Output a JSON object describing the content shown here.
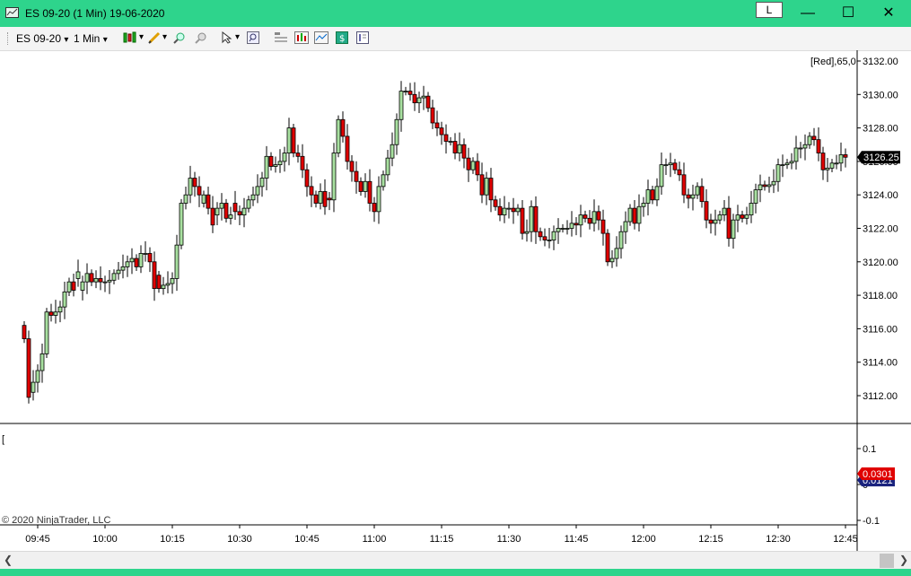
{
  "window": {
    "title": "ES 09-20 (1 Min)  19-06-2020",
    "l_button": "L",
    "minimize": "—",
    "maximize": "☐",
    "close": "✕"
  },
  "toolbar": {
    "instrument": "ES 09-20",
    "interval": "1 Min",
    "dropdown_arrow": "▾"
  },
  "price_panel": {
    "indicator_label": "[Red],65,0",
    "current_price": "3126.25",
    "y_ticks": [
      "3132.00",
      "3130.00",
      "3128.00",
      "3126.00",
      "3124.00",
      "3122.00",
      "3120.00",
      "3118.00",
      "3116.00",
      "3114.00",
      "3112.00"
    ],
    "up_color": "#a8e0a0",
    "down_color": "#e00000"
  },
  "lower_panel": {
    "label": "[",
    "y_ticks": [
      "0.1",
      "0",
      "-0.1"
    ],
    "value_red": "0.0301",
    "value_navy": "0.0121",
    "copyright": "© 2020 NinjaTrader, LLC"
  },
  "x_ticks": [
    "09:45",
    "10:00",
    "10:15",
    "10:30",
    "10:45",
    "11:00",
    "11:15",
    "11:30",
    "11:45",
    "12:00",
    "12:15",
    "12:30",
    "12:45"
  ],
  "chart_data": {
    "type": "candlestick",
    "ylim": [
      3111,
      3132.5
    ],
    "x": [
      "09:42",
      "09:43",
      "09:44",
      "09:45",
      "09:46",
      "09:47",
      "09:48",
      "09:49",
      "09:50",
      "09:51",
      "09:52",
      "09:53",
      "09:54",
      "09:55",
      "09:56",
      "09:57",
      "09:58",
      "09:59",
      "10:00",
      "10:01",
      "10:02",
      "10:03",
      "10:04",
      "10:05",
      "10:06",
      "10:07",
      "10:08",
      "10:09",
      "10:10",
      "10:11",
      "10:12",
      "10:13",
      "10:14",
      "10:15",
      "10:16",
      "10:17",
      "10:18",
      "10:19",
      "10:20",
      "10:21",
      "10:22",
      "10:23",
      "10:24",
      "10:25",
      "10:26",
      "10:27",
      "10:28",
      "10:29",
      "10:30",
      "10:31",
      "10:32",
      "10:33",
      "10:34",
      "10:35",
      "10:36",
      "10:37",
      "10:38",
      "10:39",
      "10:40",
      "10:41",
      "10:42",
      "10:43",
      "10:44",
      "10:45",
      "10:46",
      "10:47",
      "10:48",
      "10:49",
      "10:50",
      "10:51",
      "10:52",
      "10:53",
      "10:54",
      "10:55",
      "10:56",
      "10:57",
      "10:58",
      "10:59",
      "11:00",
      "11:01",
      "11:02",
      "11:03",
      "11:04",
      "11:05",
      "11:06",
      "11:07",
      "11:08",
      "11:09",
      "11:10",
      "11:11",
      "11:12",
      "11:13",
      "11:14",
      "11:15",
      "11:16",
      "11:17",
      "11:18",
      "11:19",
      "11:20",
      "11:21",
      "11:22",
      "11:23",
      "11:24",
      "11:25",
      "11:26",
      "11:27",
      "11:28",
      "11:29",
      "11:30",
      "11:31",
      "11:32",
      "11:33",
      "11:34",
      "11:35",
      "11:36",
      "11:37",
      "11:38",
      "11:39",
      "11:40",
      "11:41",
      "11:42",
      "11:43",
      "11:44",
      "11:45",
      "11:46",
      "11:47",
      "11:48",
      "11:49",
      "11:50",
      "11:51",
      "11:52",
      "11:53",
      "11:54",
      "11:55",
      "11:56",
      "11:57",
      "11:58",
      "11:59",
      "12:00",
      "12:01",
      "12:02",
      "12:03",
      "12:04",
      "12:05",
      "12:06",
      "12:07",
      "12:08",
      "12:09",
      "12:10",
      "12:11",
      "12:12",
      "12:13",
      "12:14",
      "12:15",
      "12:16",
      "12:17",
      "12:18",
      "12:19",
      "12:20",
      "12:21",
      "12:22",
      "12:23",
      "12:24",
      "12:25",
      "12:26",
      "12:27",
      "12:28",
      "12:29",
      "12:30",
      "12:31",
      "12:32",
      "12:33",
      "12:34",
      "12:35",
      "12:36",
      "12:37",
      "12:38",
      "12:39",
      "12:40",
      "12:41",
      "12:42",
      "12:43",
      "12:44",
      "12:45",
      "12:46"
    ],
    "open": [
      3116.2,
      3115.4,
      3112.2,
      3112.8,
      3113.5,
      3114.5,
      3117.0,
      3116.8,
      3117.0,
      3117.3,
      3118.2,
      3118.8,
      3119.0,
      3118.3,
      3118.8,
      3119.3,
      3118.8,
      3119.0,
      3118.8,
      3118.8,
      3118.9,
      3119.3,
      3119.5,
      3119.7,
      3120.0,
      3120.2,
      3119.7,
      3120.5,
      3120.5,
      3120.0,
      3119.2,
      3118.4,
      3118.6,
      3118.7,
      3119.0,
      3121.0,
      3123.5,
      3124.0,
      3125.0,
      3124.5,
      3123.5,
      3124.0,
      3123.2,
      3122.8,
      3123.2,
      3123.5,
      3122.6,
      3123.5,
      3123.0,
      3122.8,
      3123.2,
      3123.7,
      3124.0,
      3124.5,
      3125.0,
      3126.3,
      3125.7,
      3125.8,
      3126.0,
      3126.5,
      3128.0,
      3126.5,
      3126.3,
      3125.5,
      3124.5,
      3124.0,
      3123.5,
      3124.2,
      3123.8,
      3123.7,
      3126.5,
      3128.5,
      3127.5,
      3126.0,
      3125.4,
      3124.8,
      3124.2,
      3124.8,
      3123.5,
      3123.0,
      3124.5,
      3125.2,
      3126.2,
      3127.0,
      3128.5,
      3130.2,
      3130.2,
      3130.0,
      3129.5,
      3129.8,
      3129.9,
      3129.2,
      3128.3,
      3128.0,
      3127.6,
      3127.2,
      3127.2,
      3126.5,
      3127.0,
      3126.2,
      3125.5,
      3126.0,
      3125.2,
      3124.0,
      3125.0,
      3123.7,
      3123.3,
      3122.8,
      3123.2,
      3123.2,
      3123.0,
      3123.2,
      3121.7,
      3121.8,
      3123.3,
      3121.8,
      3121.5,
      3121.3,
      3121.3,
      3121.8,
      3122.0,
      3122.0,
      3122.0,
      3122.3,
      3122.2,
      3122.8,
      3122.6,
      3122.3,
      3123.0,
      3122.5,
      3121.7,
      3120.0,
      3120.2,
      3120.8,
      3121.8,
      3122.4,
      3123.2,
      3122.3,
      3123.3,
      3123.5,
      3124.3,
      3123.7,
      3124.5,
      3125.8,
      3125.8,
      3125.9,
      3125.5,
      3125.2,
      3124.0,
      3123.8,
      3124.0,
      3124.5,
      3123.6,
      3122.5,
      3122.3,
      3122.5,
      3122.8,
      3123.2,
      3121.4,
      3122.5,
      3122.8,
      3122.6,
      3122.8,
      3123.5,
      3124.3,
      3124.6,
      3124.5,
      3124.6,
      3124.8,
      3125.8,
      3125.8,
      3125.9,
      3126.0,
      3126.8,
      3126.8,
      3127.0,
      3127.5,
      3127.3,
      3126.5,
      3125.5,
      3125.6,
      3125.9,
      3125.9,
      3126.4
    ],
    "close": [
      3115.4,
      3111.9,
      3112.8,
      3113.5,
      3114.5,
      3117.0,
      3116.8,
      3117.0,
      3117.3,
      3118.2,
      3118.8,
      3118.3,
      3119.4,
      3118.8,
      3119.3,
      3118.8,
      3119.0,
      3118.8,
      3118.8,
      3118.9,
      3119.3,
      3119.5,
      3119.7,
      3120.0,
      3120.2,
      3119.7,
      3120.5,
      3120.5,
      3120.0,
      3118.4,
      3118.4,
      3118.6,
      3118.7,
      3119.0,
      3121.0,
      3123.5,
      3124.0,
      3125.0,
      3124.5,
      3124.0,
      3124.0,
      3123.2,
      3122.2,
      3123.2,
      3123.5,
      3122.6,
      3122.8,
      3123.0,
      3122.8,
      3123.2,
      3123.7,
      3124.0,
      3124.5,
      3125.0,
      3126.3,
      3125.7,
      3125.8,
      3126.0,
      3126.5,
      3128.0,
      3126.5,
      3126.3,
      3125.5,
      3124.5,
      3124.0,
      3123.5,
      3124.2,
      3123.3,
      3123.7,
      3126.5,
      3128.5,
      3127.5,
      3126.0,
      3125.4,
      3124.8,
      3124.2,
      3124.8,
      3123.5,
      3123.0,
      3124.5,
      3125.2,
      3126.2,
      3127.0,
      3128.5,
      3130.2,
      3130.2,
      3130.0,
      3129.5,
      3129.8,
      3129.9,
      3129.2,
      3128.3,
      3128.0,
      3127.6,
      3127.2,
      3127.2,
      3126.5,
      3127.0,
      3126.2,
      3125.5,
      3126.0,
      3125.2,
      3124.0,
      3125.0,
      3123.7,
      3123.3,
      3122.8,
      3123.2,
      3123.2,
      3123.0,
      3123.2,
      3121.7,
      3121.8,
      3123.3,
      3121.8,
      3121.5,
      3121.3,
      3121.3,
      3121.8,
      3122.0,
      3122.0,
      3122.0,
      3122.3,
      3122.2,
      3122.8,
      3122.6,
      3122.3,
      3123.0,
      3122.5,
      3121.7,
      3120.0,
      3120.2,
      3120.8,
      3121.8,
      3122.4,
      3123.2,
      3122.3,
      3123.3,
      3123.5,
      3124.3,
      3123.7,
      3124.5,
      3125.8,
      3125.8,
      3125.9,
      3125.5,
      3125.2,
      3124.0,
      3123.8,
      3124.0,
      3124.5,
      3123.6,
      3122.5,
      3122.3,
      3122.5,
      3122.8,
      3123.2,
      3121.4,
      3122.5,
      3122.8,
      3122.6,
      3122.8,
      3123.5,
      3124.3,
      3124.6,
      3124.5,
      3124.6,
      3124.8,
      3125.8,
      3125.8,
      3125.9,
      3126.0,
      3126.8,
      3126.8,
      3127.0,
      3127.5,
      3127.3,
      3126.5,
      3125.5,
      3125.6,
      3125.9,
      3125.9,
      3126.4,
      3126.25
    ],
    "last_price": 3126.25,
    "lower_values": {
      "red": 0.0301,
      "navy": 0.0121
    },
    "lower_ylim": [
      -0.11,
      0.135
    ]
  }
}
